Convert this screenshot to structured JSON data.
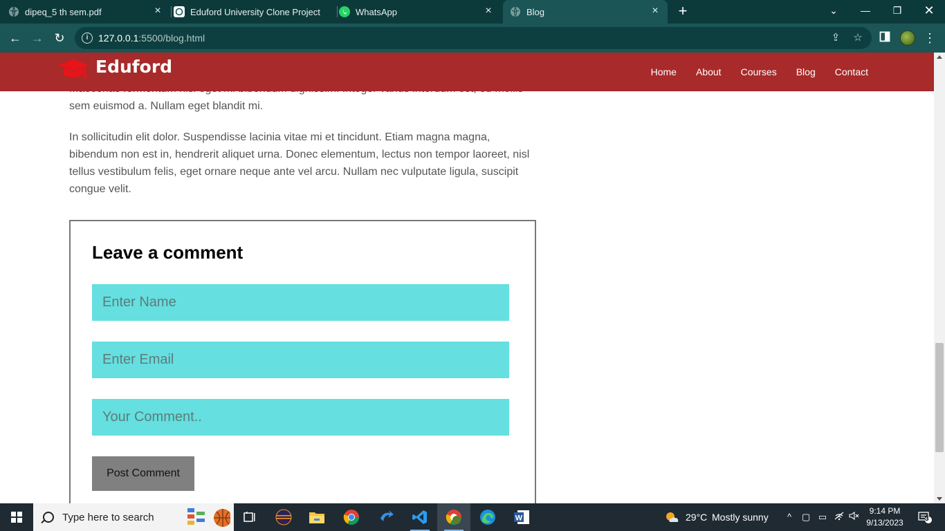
{
  "browser": {
    "tabs": [
      {
        "title": "dipeq_5 th sem.pdf",
        "icon": "globe-icon"
      },
      {
        "title": "Eduford University Clone Project",
        "icon": "chatgpt-icon"
      },
      {
        "title": "WhatsApp",
        "icon": "whatsapp-icon"
      },
      {
        "title": "Blog",
        "icon": "globe-icon",
        "active": true
      }
    ],
    "address": {
      "host": "127.0.0.1",
      "rest": ":5500/blog.html"
    }
  },
  "site": {
    "brand": "Eduford",
    "nav": [
      "Home",
      "About",
      "Courses",
      "Blog",
      "Contact"
    ],
    "article": {
      "para1": "Maecenas fermentum nisl eget mi bibendum dignissim. Integer varius interdum est, eu mollis sem euismod a. Nullam eget blandit mi.",
      "para2": "In sollicitudin elit dolor. Suspendisse lacinia vitae mi et tincidunt. Etiam magna magna, bibendum non est in, hendrerit aliquet urna. Donec elementum, lectus non tempor laoreet, nisl tellus vestibulum felis, eget ornare neque ante vel arcu. Nullam nec vulputate ligula, suscipit congue velit."
    },
    "comment": {
      "heading": "Leave a comment",
      "name_placeholder": "Enter Name",
      "email_placeholder": "Enter Email",
      "comment_placeholder": "Your Comment..",
      "submit_label": "Post Comment"
    },
    "colors": {
      "header": "#a82a2a",
      "field": "#65dfdf",
      "button": "#808080"
    }
  },
  "taskbar": {
    "search_placeholder": "Type here to search",
    "weather": {
      "temp": "29°C",
      "desc": "Mostly sunny"
    },
    "time": "9:14 PM",
    "date": "9/13/2023",
    "notifications": "3"
  }
}
